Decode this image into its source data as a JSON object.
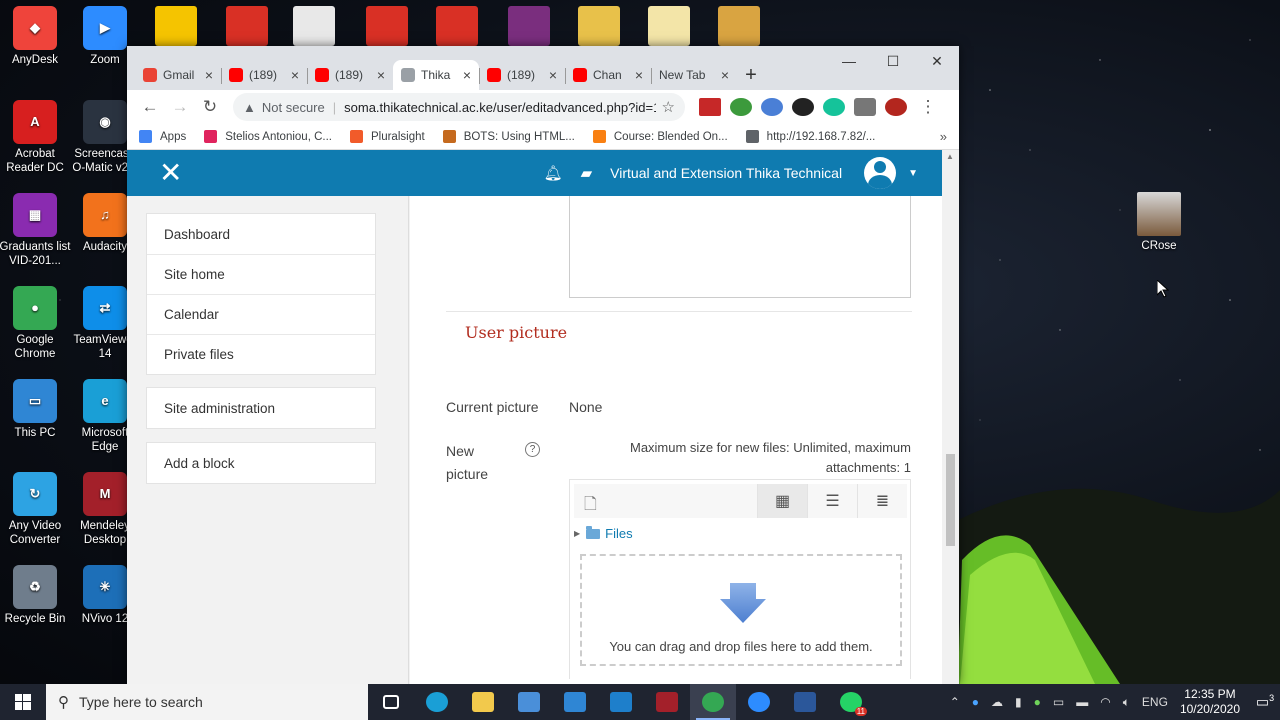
{
  "desktop": {
    "left_icons": [
      {
        "label": "AnyDesk",
        "color": "#ef443b",
        "glyph": "◆"
      },
      {
        "label": "Zoom",
        "color": "#2d8cff",
        "glyph": "▶"
      },
      {
        "label": "Acrobat Reader DC",
        "color": "#d71f1f",
        "glyph": "A"
      },
      {
        "label": "Screencast-O-Matic v2.0",
        "color": "#2a3340",
        "glyph": "◉"
      },
      {
        "label": "Graduants list VID-201...",
        "color": "#8a2bb0",
        "glyph": "▦"
      },
      {
        "label": "Audacity",
        "color": "#f2721c",
        "glyph": "♫"
      },
      {
        "label": "Google Chrome",
        "color": "#34a853",
        "glyph": "●"
      },
      {
        "label": "TeamViewer 14",
        "color": "#0e8ee9",
        "glyph": "⇄"
      },
      {
        "label": "This PC",
        "color": "#2f86d4",
        "glyph": "▭"
      },
      {
        "label": "Microsoft Edge",
        "color": "#1a9fd6",
        "glyph": "e"
      },
      {
        "label": "Any Video Converter",
        "color": "#2da3e3",
        "glyph": "↻"
      },
      {
        "label": "Mendeley Desktop",
        "color": "#a3202a",
        "glyph": "M"
      },
      {
        "label": "Recycle Bin",
        "color": "#6f7d8c",
        "glyph": "♻"
      },
      {
        "label": "NVivo 12",
        "color": "#1d6fb8",
        "glyph": "✳"
      }
    ],
    "right_icon": {
      "label": "CRose"
    }
  },
  "browser": {
    "tabs": [
      {
        "title": "Gmail",
        "favicon": "gmail-icon",
        "color": "#ea4335",
        "active": false
      },
      {
        "title": "(189)",
        "favicon": "youtube-icon",
        "color": "#ff0000",
        "active": false
      },
      {
        "title": "(189)",
        "favicon": "youtube-icon",
        "color": "#ff0000",
        "active": false
      },
      {
        "title": "Thika",
        "favicon": "page-icon",
        "color": "#9aa0a6",
        "active": true
      },
      {
        "title": "(189)",
        "favicon": "youtube-icon",
        "color": "#ff0000",
        "active": false
      },
      {
        "title": "Chan",
        "favicon": "youtube-icon",
        "color": "#ff0000",
        "active": false
      },
      {
        "title": "New Tab",
        "favicon": "",
        "color": "",
        "active": false
      }
    ],
    "tab_close": "×",
    "new_tab": "+",
    "window_controls": {
      "minimize": "—",
      "maximize": "☐",
      "close": "✕"
    },
    "nav": {
      "back": "←",
      "forward": "→",
      "reload": "↻"
    },
    "omnibox": {
      "security": "Not secure",
      "url": "soma.thikatechnical.ac.ke/user/editadvanced.php?id=1...",
      "star": "☆"
    },
    "bookmarks": [
      {
        "label": "Apps",
        "color": "#4285f4"
      },
      {
        "label": "Stelios Antoniou, C...",
        "color": "#e0245e"
      },
      {
        "label": "Pluralsight",
        "color": "#f15b2a"
      },
      {
        "label": "BOTS: Using HTML...",
        "color": "#c56a1e"
      },
      {
        "label": "Course: Blended On...",
        "color": "#f98012"
      },
      {
        "label": "http://192.168.7.82/...",
        "color": "#5f6368"
      }
    ],
    "bookmarks_more": "»"
  },
  "moodle": {
    "navbar": {
      "close": "✕",
      "site_name": "Virtual and Extension Thika Technical",
      "caret": "▼"
    },
    "drawer": {
      "nav_items": [
        "Dashboard",
        "Site home",
        "Calendar",
        "Private files"
      ],
      "admin_item": "Site administration",
      "add_block": "Add a block"
    },
    "form": {
      "section_title": "User picture",
      "current_picture_label": "Current picture",
      "current_picture_value": "None",
      "new_picture_label": "New picture",
      "help": "?",
      "max_size": "Maximum size for new files: Unlimited, maximum attachments: 1",
      "files_label": "Files",
      "dropzone_text": "You can drag and drop files here to add them."
    }
  },
  "taskbar": {
    "search_placeholder": "Type here to search",
    "apps": [
      {
        "name": "task-view",
        "color": "#ffffff"
      },
      {
        "name": "edge",
        "color": "#1a9fd6"
      },
      {
        "name": "file-explorer",
        "color": "#f2c94c"
      },
      {
        "name": "store",
        "color": "#4a8fd9"
      },
      {
        "name": "mail",
        "color": "#2f86d4"
      },
      {
        "name": "publisher",
        "color": "#1e7fcb"
      },
      {
        "name": "mendeley",
        "color": "#a3202a"
      },
      {
        "name": "chrome",
        "color": "#34a853"
      },
      {
        "name": "zoom",
        "color": "#2d8cff"
      },
      {
        "name": "word",
        "color": "#2b579a"
      },
      {
        "name": "whatsapp",
        "color": "#25d366"
      }
    ],
    "whatsapp_badge": "11",
    "language": "ENG",
    "time": "12:35 PM",
    "date": "10/20/2020",
    "notification_count": "3"
  }
}
